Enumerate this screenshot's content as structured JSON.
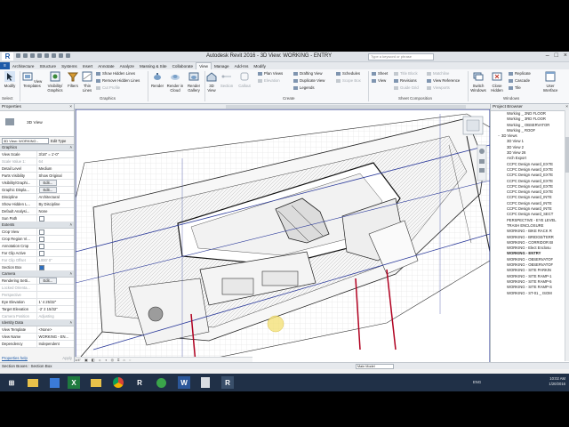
{
  "app": {
    "title": "Autodesk Revit 2016  -  3D View: WORKING - ENTRY",
    "search_placeholder": "Type a keyword or phrase"
  },
  "ribbon": {
    "tabs": [
      "Architecture",
      "Structure",
      "Systems",
      "Insert",
      "Annotate",
      "Analyze",
      "Massing & Site",
      "Collaborate",
      "View",
      "Manage",
      "Add-Ins",
      "Modify"
    ],
    "active_tab": "View",
    "buttons": {
      "modify": "Modify",
      "view_templates": "View Templates",
      "visibility_graphics": "Visibility/ Graphics",
      "filters": "Filters",
      "thin_lines": "Thin Lines",
      "render": "Render",
      "render_cloud": "Render in Cloud",
      "render_gallery": "Render Gallery",
      "view_3d": "3D View",
      "section": "Section",
      "callout": "Callout",
      "sheet": "Sheet",
      "view": "View",
      "switch_windows": "Switch Windows",
      "close_hidden": "Close Hidden",
      "tile": "Tile",
      "user_interface": "User Interface"
    },
    "small": {
      "show_hidden": "Show Hidden Lines",
      "remove_hidden": "Remove Hidden Lines",
      "cut_profile": "Cut Profile",
      "plan_views": "Plan Views",
      "elevation": "Elevation",
      "drafting_view": "Drafting View",
      "duplicate_view": "Duplicate View",
      "legends": "Legends",
      "schedules": "Schedules",
      "scope_box": "Scope Box",
      "title_block": "Title Block",
      "revisions": "Revisions",
      "guide_grid": "Guide Grid",
      "matchline": "Matchline",
      "view_reference": "View Reference",
      "viewports": "Viewports",
      "replicate": "Replicate",
      "cascade": "Cascade"
    },
    "panels": {
      "select": "Select",
      "graphics": "Graphics",
      "create": "Create",
      "sheet_composition": "Sheet Composition",
      "windows": "Windows"
    }
  },
  "properties": {
    "title": "Properties",
    "type_name": "3D View",
    "instance": "3D View: WORKING -",
    "edit_type": "Edit Type",
    "groups": {
      "graphics": "Graphics",
      "extents": "Extents",
      "camera": "Camera",
      "identity": "Identity Data"
    },
    "graphics_rows": [
      {
        "k": "View Scale",
        "v": "3/16\" = 1'-0\""
      },
      {
        "k": "Scale Value  1:",
        "v": "64"
      },
      {
        "k": "Detail Level",
        "v": "Medium"
      },
      {
        "k": "Parts Visibility",
        "v": "Show Original"
      },
      {
        "k": "Visibility/Graphi...",
        "v": "Edit..."
      },
      {
        "k": "Graphic Displa...",
        "v": "Edit..."
      },
      {
        "k": "Discipline",
        "v": "Architectural"
      },
      {
        "k": "Show Hidden L...",
        "v": "By Discipline"
      },
      {
        "k": "Default Analysi...",
        "v": "None"
      },
      {
        "k": "Sun Path",
        "v": ""
      }
    ],
    "extents_rows": [
      {
        "k": "Crop View",
        "v": ""
      },
      {
        "k": "Crop Region Vi...",
        "v": ""
      },
      {
        "k": "Annotation Crop",
        "v": ""
      },
      {
        "k": "Far Clip Active",
        "v": ""
      },
      {
        "k": "Far Clip Offset",
        "v": "1000' 0\""
      },
      {
        "k": "Section Box",
        "v": ""
      }
    ],
    "camera_rows": [
      {
        "k": "Rendering Setti...",
        "v": "Edit..."
      },
      {
        "k": "Locked Orienta...",
        "v": ""
      },
      {
        "k": "Perspective",
        "v": ""
      },
      {
        "k": "Eye Elevation",
        "v": "1' 4 25/32\""
      },
      {
        "k": "Target Elevation",
        "v": "-2' 2 15/32\""
      },
      {
        "k": "Camera Position",
        "v": "Adjusting"
      }
    ],
    "identity_rows": [
      {
        "k": "View Template",
        "v": "<None>"
      },
      {
        "k": "View Name",
        "v": "WORKING - EN..."
      },
      {
        "k": "Dependency",
        "v": "Independent"
      }
    ],
    "help_link": "Properties help",
    "apply": "Apply"
  },
  "browser": {
    "title": "Project Browser",
    "items": [
      {
        "t": "Working _ 2ND FLOOR",
        "lvl": 2
      },
      {
        "t": "Working _ 3RD FLOOR",
        "lvl": 2
      },
      {
        "t": "Working _ OBSERVATOR",
        "lvl": 2
      },
      {
        "t": "Working _ ROOF",
        "lvl": 2
      },
      {
        "t": "3D Views",
        "lvl": 1
      },
      {
        "t": "3D View 1",
        "lvl": 2
      },
      {
        "t": "3D View 2",
        "lvl": 2
      },
      {
        "t": "3D View 26",
        "lvl": 2
      },
      {
        "t": "Arch Export",
        "lvl": 2
      },
      {
        "t": "CCPC Design Award_EXTE",
        "lvl": 2
      },
      {
        "t": "CCPC Design Award_EXTE",
        "lvl": 2
      },
      {
        "t": "CCPC Design Award_EXTE",
        "lvl": 2
      },
      {
        "t": "CCPC Design Award_EXTE",
        "lvl": 2
      },
      {
        "t": "CCPC Design Award_EXTE",
        "lvl": 2
      },
      {
        "t": "CCPC Design Award_EXTE",
        "lvl": 2
      },
      {
        "t": "CCPC Design Award_INTE",
        "lvl": 2
      },
      {
        "t": "CCPC Design Award_INTE",
        "lvl": 2
      },
      {
        "t": "CCPC Design Award_INTE",
        "lvl": 2
      },
      {
        "t": "CCPC Design Award_SECT",
        "lvl": 2
      },
      {
        "t": "PERSPECTIVE - EYE LEVEL",
        "lvl": 2
      },
      {
        "t": "TRASH ENCLOSURE",
        "lvl": 2
      },
      {
        "t": "WORKING - BIKE RACK R",
        "lvl": 2
      },
      {
        "t": "WORKING - BRIDGE/TERR",
        "lvl": 2
      },
      {
        "t": "WORKING - CORRIDOR BI",
        "lvl": 2
      },
      {
        "t": "WORKING - Elect Enclosu",
        "lvl": 2
      },
      {
        "t": "WORKING - ENTRY",
        "lvl": 2,
        "bold": true
      },
      {
        "t": "WORKING - OBSERVATOF",
        "lvl": 2
      },
      {
        "t": "WORKING - OBSERVATOF",
        "lvl": 2
      },
      {
        "t": "WORKING - SITE PARKIN",
        "lvl": 2
      },
      {
        "t": "WORKING - SITE RAMP-1",
        "lvl": 2
      },
      {
        "t": "WORKING - SITE RAMP-5",
        "lvl": 2
      },
      {
        "t": "WORKING - SITE RAMP-S",
        "lvl": 2
      },
      {
        "t": "WORKING - ST-01 _ ISOM",
        "lvl": 2
      }
    ]
  },
  "status": {
    "left": "Section Boxes : Section Box",
    "model": "Main Model"
  },
  "view_controls": "1/4\"  ",
  "taskbar": {
    "time": "10:02 AM",
    "date": "1/20/2016",
    "lang": "ENG"
  }
}
